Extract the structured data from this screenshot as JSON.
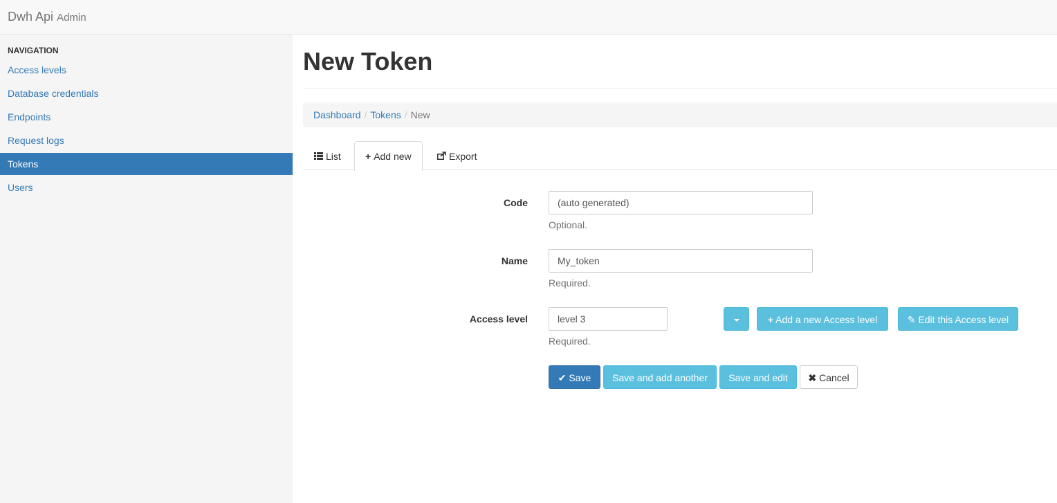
{
  "navbar": {
    "brand": "Dwh Api",
    "brand_sub": "Admin"
  },
  "sidebar": {
    "header": "NAVIGATION",
    "items": [
      {
        "label": "Access levels"
      },
      {
        "label": "Database credentials"
      },
      {
        "label": "Endpoints"
      },
      {
        "label": "Request logs"
      },
      {
        "label": "Tokens",
        "active": true
      },
      {
        "label": "Users"
      }
    ]
  },
  "page": {
    "title": "New Token"
  },
  "breadcrumb": {
    "items": [
      "Dashboard",
      "Tokens",
      "New"
    ],
    "separator": "/"
  },
  "tabs": [
    {
      "label": "List",
      "icon": "list-icon"
    },
    {
      "label": "Add new",
      "icon": "plus-icon",
      "active": true
    },
    {
      "label": "Export",
      "icon": "share-icon"
    }
  ],
  "form": {
    "code": {
      "label": "Code",
      "value": "(auto generated)",
      "help": "Optional."
    },
    "name": {
      "label": "Name",
      "value": "My_token",
      "help": "Required."
    },
    "access_level": {
      "label": "Access level",
      "value": "level 3",
      "help": "Required.",
      "add_label": "Add a new Access level",
      "edit_label": "Edit this Access level"
    }
  },
  "actions": {
    "save": "Save",
    "save_add_another": "Save and add another",
    "save_edit": "Save and edit",
    "cancel": "Cancel"
  },
  "colors": {
    "primary": "#337ab7",
    "info": "#5bc0de",
    "sidebar_bg": "#f5f5f5"
  }
}
